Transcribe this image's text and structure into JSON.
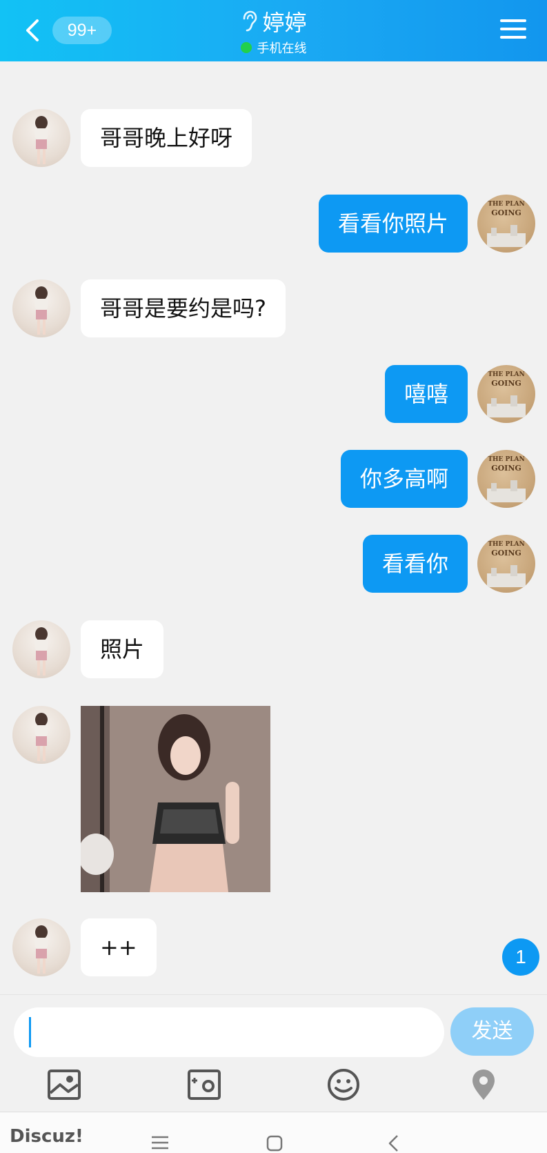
{
  "header": {
    "badge": "99+",
    "title": "婷婷",
    "status": "手机在线",
    "status_color": "#22d04b",
    "accent": "#1aa9f3"
  },
  "messages": [
    {
      "from": "them",
      "type": "text",
      "text": "哥哥晚上好呀"
    },
    {
      "from": "me",
      "type": "text",
      "text": "看看你照片"
    },
    {
      "from": "them",
      "type": "text",
      "text": "哥哥是要约是吗?"
    },
    {
      "from": "me",
      "type": "text",
      "text": "嘻嘻"
    },
    {
      "from": "me",
      "type": "text",
      "text": "你多高啊"
    },
    {
      "from": "me",
      "type": "text",
      "text": "看看你"
    },
    {
      "from": "them",
      "type": "text",
      "text": "照片"
    },
    {
      "from": "them",
      "type": "image"
    },
    {
      "from": "them",
      "type": "text",
      "text": "++"
    }
  ],
  "my_avatar_text": {
    "line1": "THE PLAN",
    "line2": "GOING"
  },
  "unread_count": "1",
  "composer": {
    "placeholder": "",
    "send_label": "发送"
  },
  "toolbar": {
    "icons": [
      "gallery-icon",
      "camera-icon",
      "emoji-icon",
      "location-icon"
    ]
  },
  "system": {
    "watermark": "Discuz!"
  },
  "colors": {
    "outgoing_bubble": "#0d99f3",
    "incoming_bubble": "#ffffff",
    "send_button": "#8fcff8"
  }
}
